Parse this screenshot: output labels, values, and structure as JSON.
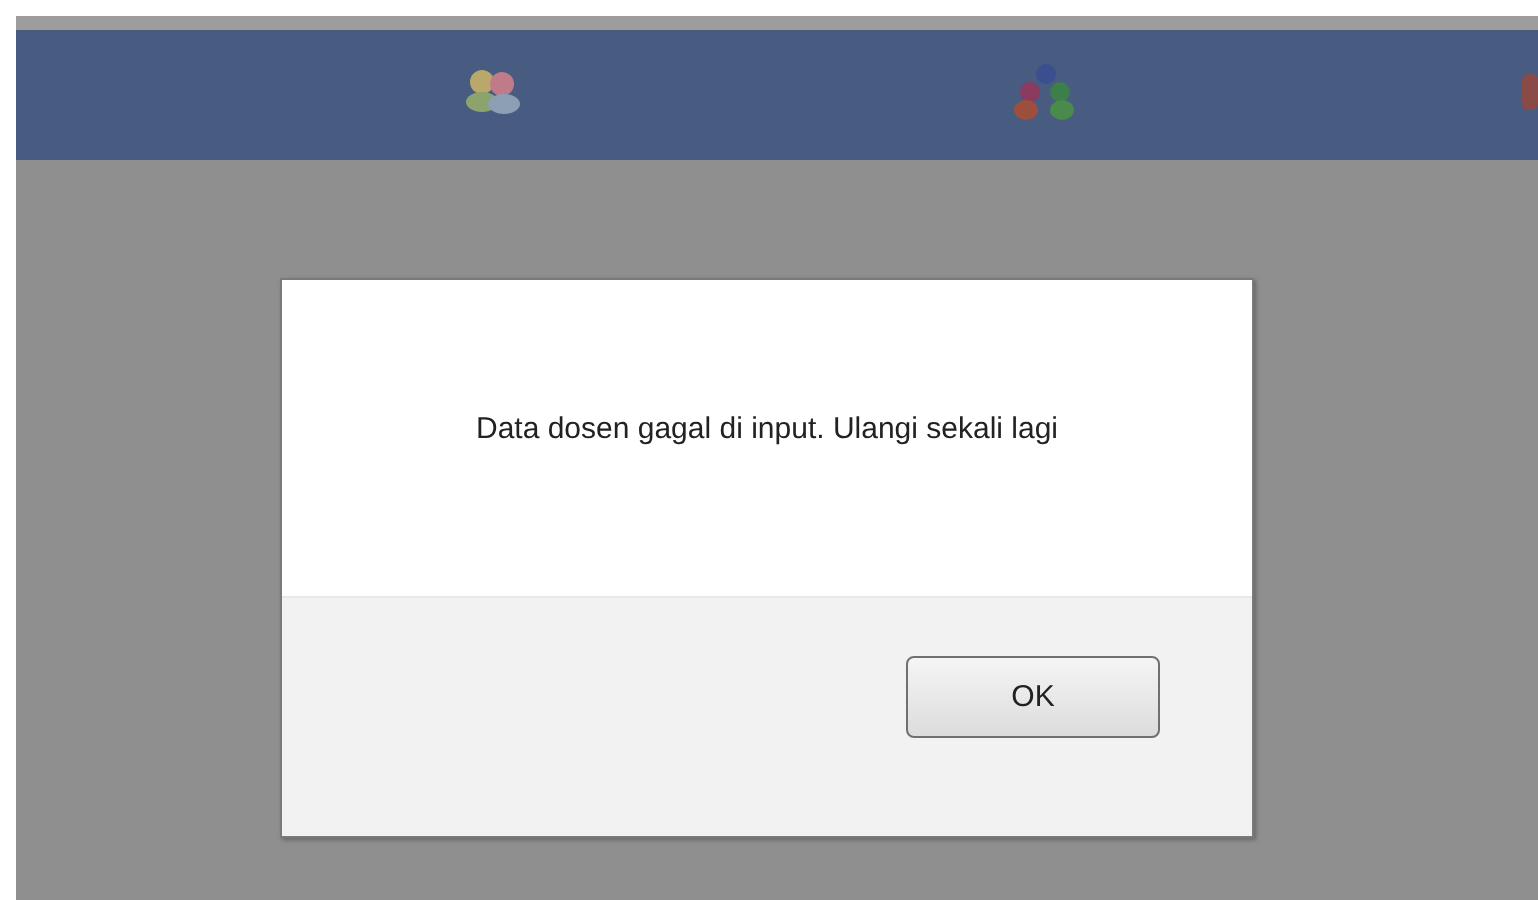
{
  "dialog": {
    "message": "Data dosen gagal di input. Ulangi sekali lagi",
    "buttons": [
      "OK"
    ]
  }
}
